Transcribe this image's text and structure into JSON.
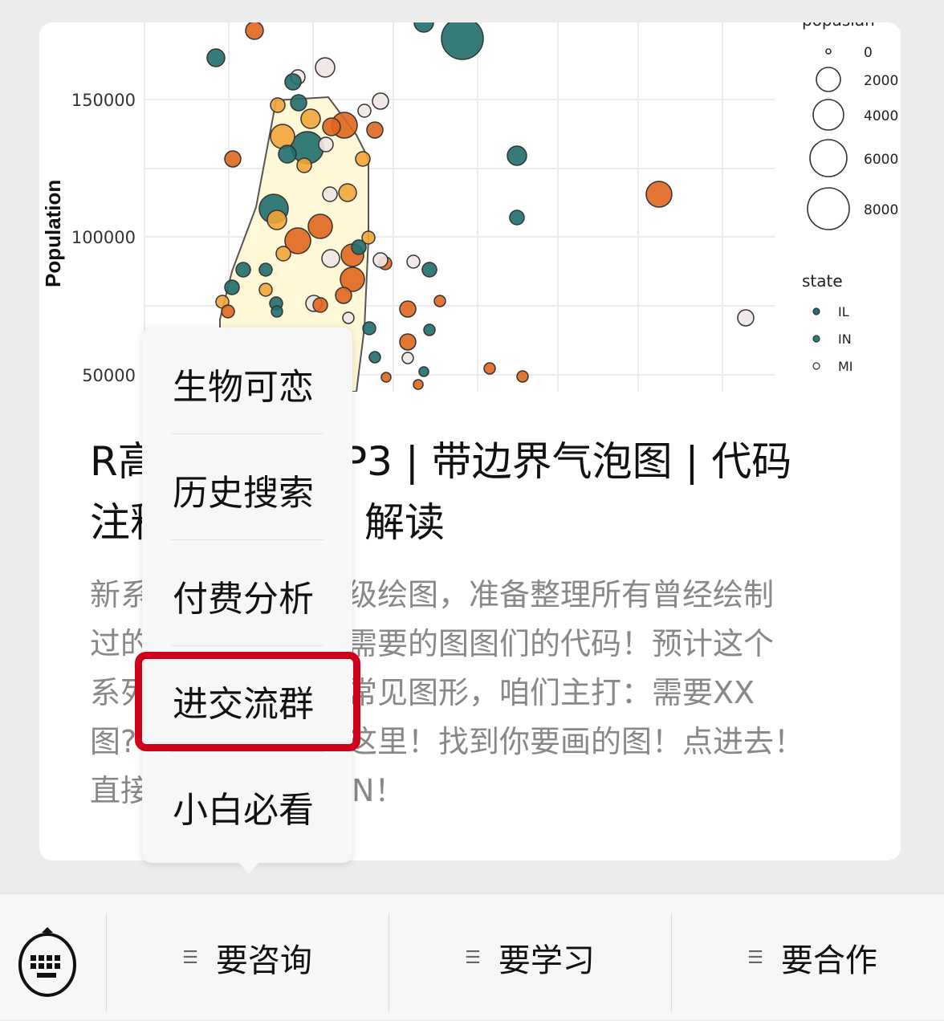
{
  "chart_data": {
    "type": "scatter",
    "ylabel": "Population",
    "yticks": [
      "150000",
      "100000",
      "50000"
    ],
    "ytick_values": [
      150000,
      100000,
      50000
    ],
    "grid": true,
    "legend_placement": "right",
    "size_legend": {
      "title": "popasian",
      "entries": [
        "0",
        "2000",
        "4000",
        "6000",
        "8000"
      ]
    },
    "color_legend": {
      "title": "state",
      "entries": [
        "IL",
        "IN",
        "MI"
      ]
    },
    "colors": {
      "teal": "#1f6e6e",
      "orange": "#e0661f",
      "amber": "#f2a43a",
      "pale": "#f1e6e4",
      "hull": "#fff8d6"
    }
  },
  "article": {
    "title_line1_left": "R高",
    "title_line1_right": "P3 | 带边界气泡图 | 代码",
    "title_line2_left": "注释",
    "title_line2_right": "解读",
    "desc_lines": [
      {
        "left": "新系",
        "right": "级绘图，准备整理所有曾经绘制"
      },
      {
        "left": "过的",
        "right": "需要的图图们的代码！预计这个"
      },
      {
        "left": "系列",
        "right": "常见图形，咱们主打：需要XX"
      },
      {
        "left": "图?",
        "right": "这里！找到你要画的图！点进去！"
      },
      {
        "left": "直接",
        "right": "N！"
      }
    ]
  },
  "popup_menu": {
    "items": [
      "生物可恋",
      "历史搜索",
      "付费分析",
      "进交流群",
      "小白必看"
    ],
    "highlighted": "进交流群",
    "highlight_color": "#d0021b"
  },
  "bottom_bar": {
    "keyboard_icon": "keyboard-icon",
    "tabs": [
      {
        "label": "要咨询",
        "icon": "menu-icon"
      },
      {
        "label": "要学习",
        "icon": "menu-icon"
      },
      {
        "label": "要合作",
        "icon": "menu-icon"
      }
    ]
  }
}
